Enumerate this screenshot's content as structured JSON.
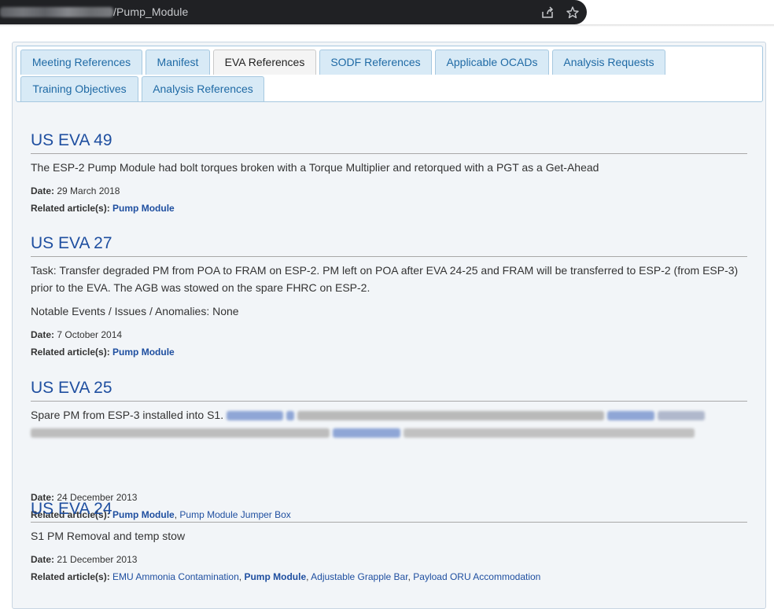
{
  "browser": {
    "url_path": "/Pump_Module"
  },
  "tabs": [
    {
      "label": "Meeting References",
      "active": false
    },
    {
      "label": "Manifest",
      "active": false
    },
    {
      "label": "EVA References",
      "active": true
    },
    {
      "label": "SODF References",
      "active": false
    },
    {
      "label": "Applicable OCADs",
      "active": false
    },
    {
      "label": "Analysis Requests",
      "active": false
    },
    {
      "label": "Training Objectives",
      "active": false
    },
    {
      "label": "Analysis References",
      "active": false
    }
  ],
  "labels": {
    "date": "Date:",
    "related": "Related article(s):",
    "comma": ","
  },
  "evas": [
    {
      "title": "US EVA 49",
      "paragraphs": [
        "The ESP-2 Pump Module had bolt torques broken with a Torque Multiplier and retorqued with a PGT as a Get-Ahead"
      ],
      "date": "29 March 2018",
      "related": [
        "Pump Module"
      ]
    },
    {
      "title": "US EVA 27",
      "paragraphs": [
        "Task: Transfer degraded PM from POA to FRAM on ESP-2. PM left on POA after EVA 24-25 and FRAM will be transferred to ESP-2 (from ESP-3) prior to the EVA. The AGB was stowed on the spare FHRC on ESP-2.",
        "Notable Events / Issues / Anomalies: None"
      ],
      "date": "7 October 2014",
      "related": [
        "Pump Module"
      ]
    },
    {
      "title": "US EVA 25",
      "paragraphs": [
        "Spare PM from ESP-3 installed into S1."
      ],
      "date": "24 December 2013",
      "related": [
        "Pump Module",
        "Pump Module Jumper Box"
      ]
    },
    {
      "title": "US EVA 24",
      "paragraphs": [
        "S1 PM Removal and temp stow"
      ],
      "date": "21 December 2013",
      "related": [
        "EMU Ammonia Contamination",
        "Pump Module",
        "Adjustable Grapple Bar",
        "Payload ORU Accommodation"
      ]
    }
  ]
}
